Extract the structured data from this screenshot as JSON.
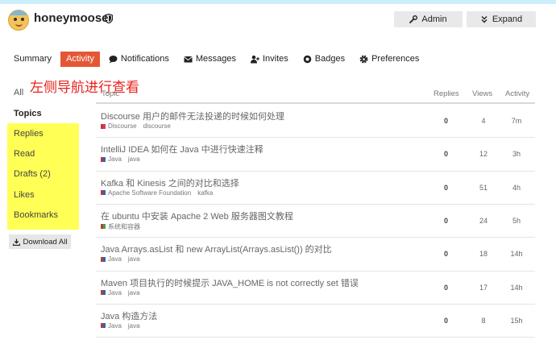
{
  "header": {
    "username": "honeymoose",
    "admin_label": "Admin",
    "expand_label": "Expand"
  },
  "tabs": [
    {
      "label": "Summary"
    },
    {
      "label": "Activity"
    },
    {
      "label": "Notifications"
    },
    {
      "label": "Messages"
    },
    {
      "label": "Invites"
    },
    {
      "label": "Badges"
    },
    {
      "label": "Preferences"
    }
  ],
  "sidebar": {
    "all": "All",
    "topics": "Topics",
    "items": [
      "Replies",
      "Read",
      "Drafts (2)",
      "Likes",
      "Bookmarks"
    ],
    "download_label": "Download All"
  },
  "annotation": "左侧导航进行查看",
  "table": {
    "headers": {
      "topic": "Topic",
      "replies": "Replies",
      "views": "Views",
      "activity": "Activity"
    },
    "rows": [
      {
        "title": "Discourse 用户的邮件无法投递的时候如何处理",
        "category": "Discourse",
        "category_color": "#d33a6e",
        "tag": "discourse",
        "replies": "0",
        "views": "4",
        "activity": "7m"
      },
      {
        "title": "IntelliJ IDEA 如何在 Java 中进行快速注释",
        "category": "Java",
        "category_color": "#2b63c4",
        "tag": "java",
        "replies": "0",
        "views": "12",
        "activity": "3h"
      },
      {
        "title": "Kafka 和 Kinesis 之间的对比和选择",
        "category": "Apache Software Foundation",
        "category_color": "#2b63c4",
        "tag": "kafka",
        "replies": "0",
        "views": "51",
        "activity": "4h"
      },
      {
        "title": "在 ubuntu 中安装 Apache 2 Web 服务器图文教程",
        "category": "系统和容器",
        "category_color": "#3aa655",
        "tag": "",
        "replies": "0",
        "views": "24",
        "activity": "5h"
      },
      {
        "title": "Java Arrays.asList 和 new ArrayList(Arrays.asList()) 的对比",
        "category": "Java",
        "category_color": "#2b63c4",
        "tag": "java",
        "replies": "0",
        "views": "18",
        "activity": "14h"
      },
      {
        "title": "Maven 项目执行的时候提示 JAVA_HOME is not correctly set 错误",
        "category": "Java",
        "category_color": "#2b63c4",
        "tag": "java",
        "replies": "0",
        "views": "17",
        "activity": "14h"
      },
      {
        "title": "Java 构造方法",
        "category": "Java",
        "category_color": "#2b63c4",
        "tag": "java",
        "replies": "0",
        "views": "8",
        "activity": "15h"
      }
    ]
  },
  "colors": {
    "accent": "#e45735",
    "highlight": "#ffff55",
    "annotation": "#e8231c",
    "topbar": "#cdeefb"
  }
}
